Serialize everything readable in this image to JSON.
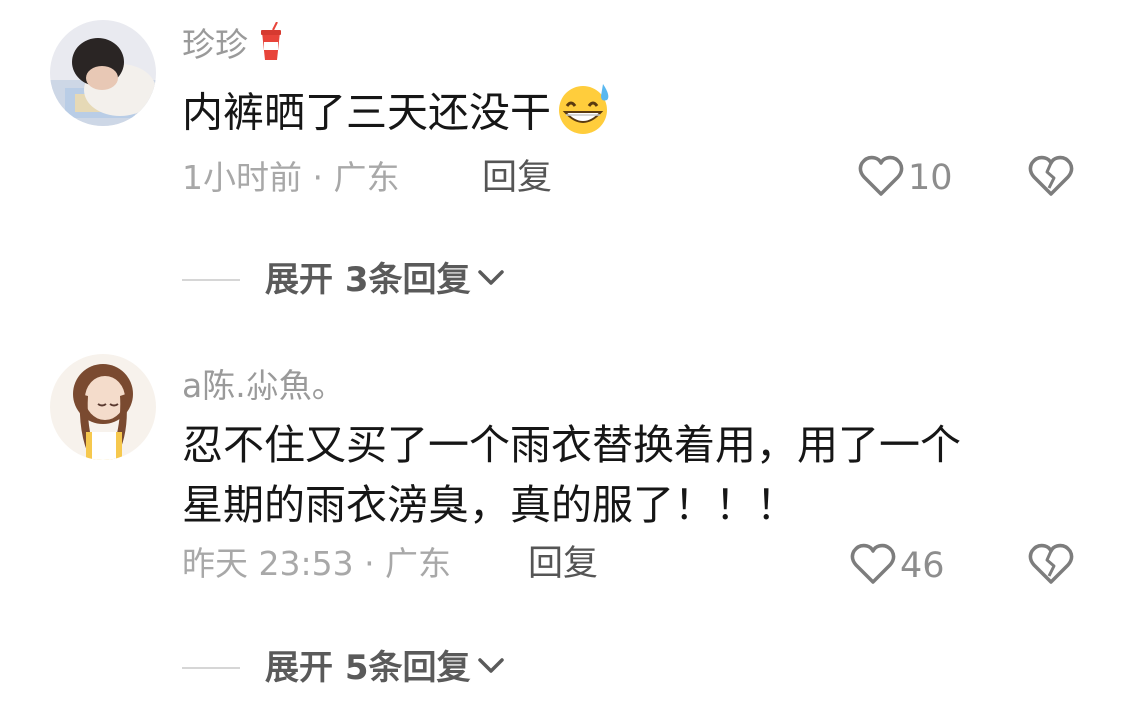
{
  "comments": [
    {
      "username": "珍珍",
      "badge_icon": "cup-drink-icon",
      "text": "内裤晒了三天还没干",
      "emoji_icon": "grinning-sweat-emoji-icon",
      "meta": "1小时前 · 广东",
      "reply_label": "回复",
      "like_count": "10",
      "expand_label": "展开 3条回复"
    },
    {
      "username": "a陈.尛魚。",
      "text_line1": "忍不住又买了一个雨衣替换着用，用了一个",
      "text_line2": "星期的雨衣滂臭，真的服了！！！",
      "meta": "昨天 23:53 · 广东",
      "reply_label": "回复",
      "like_count": "46",
      "expand_label": "展开 5条回复"
    }
  ],
  "colors": {
    "text_primary": "#161616",
    "text_secondary": "#9a9a9a",
    "icon": "#7d7d7d"
  }
}
